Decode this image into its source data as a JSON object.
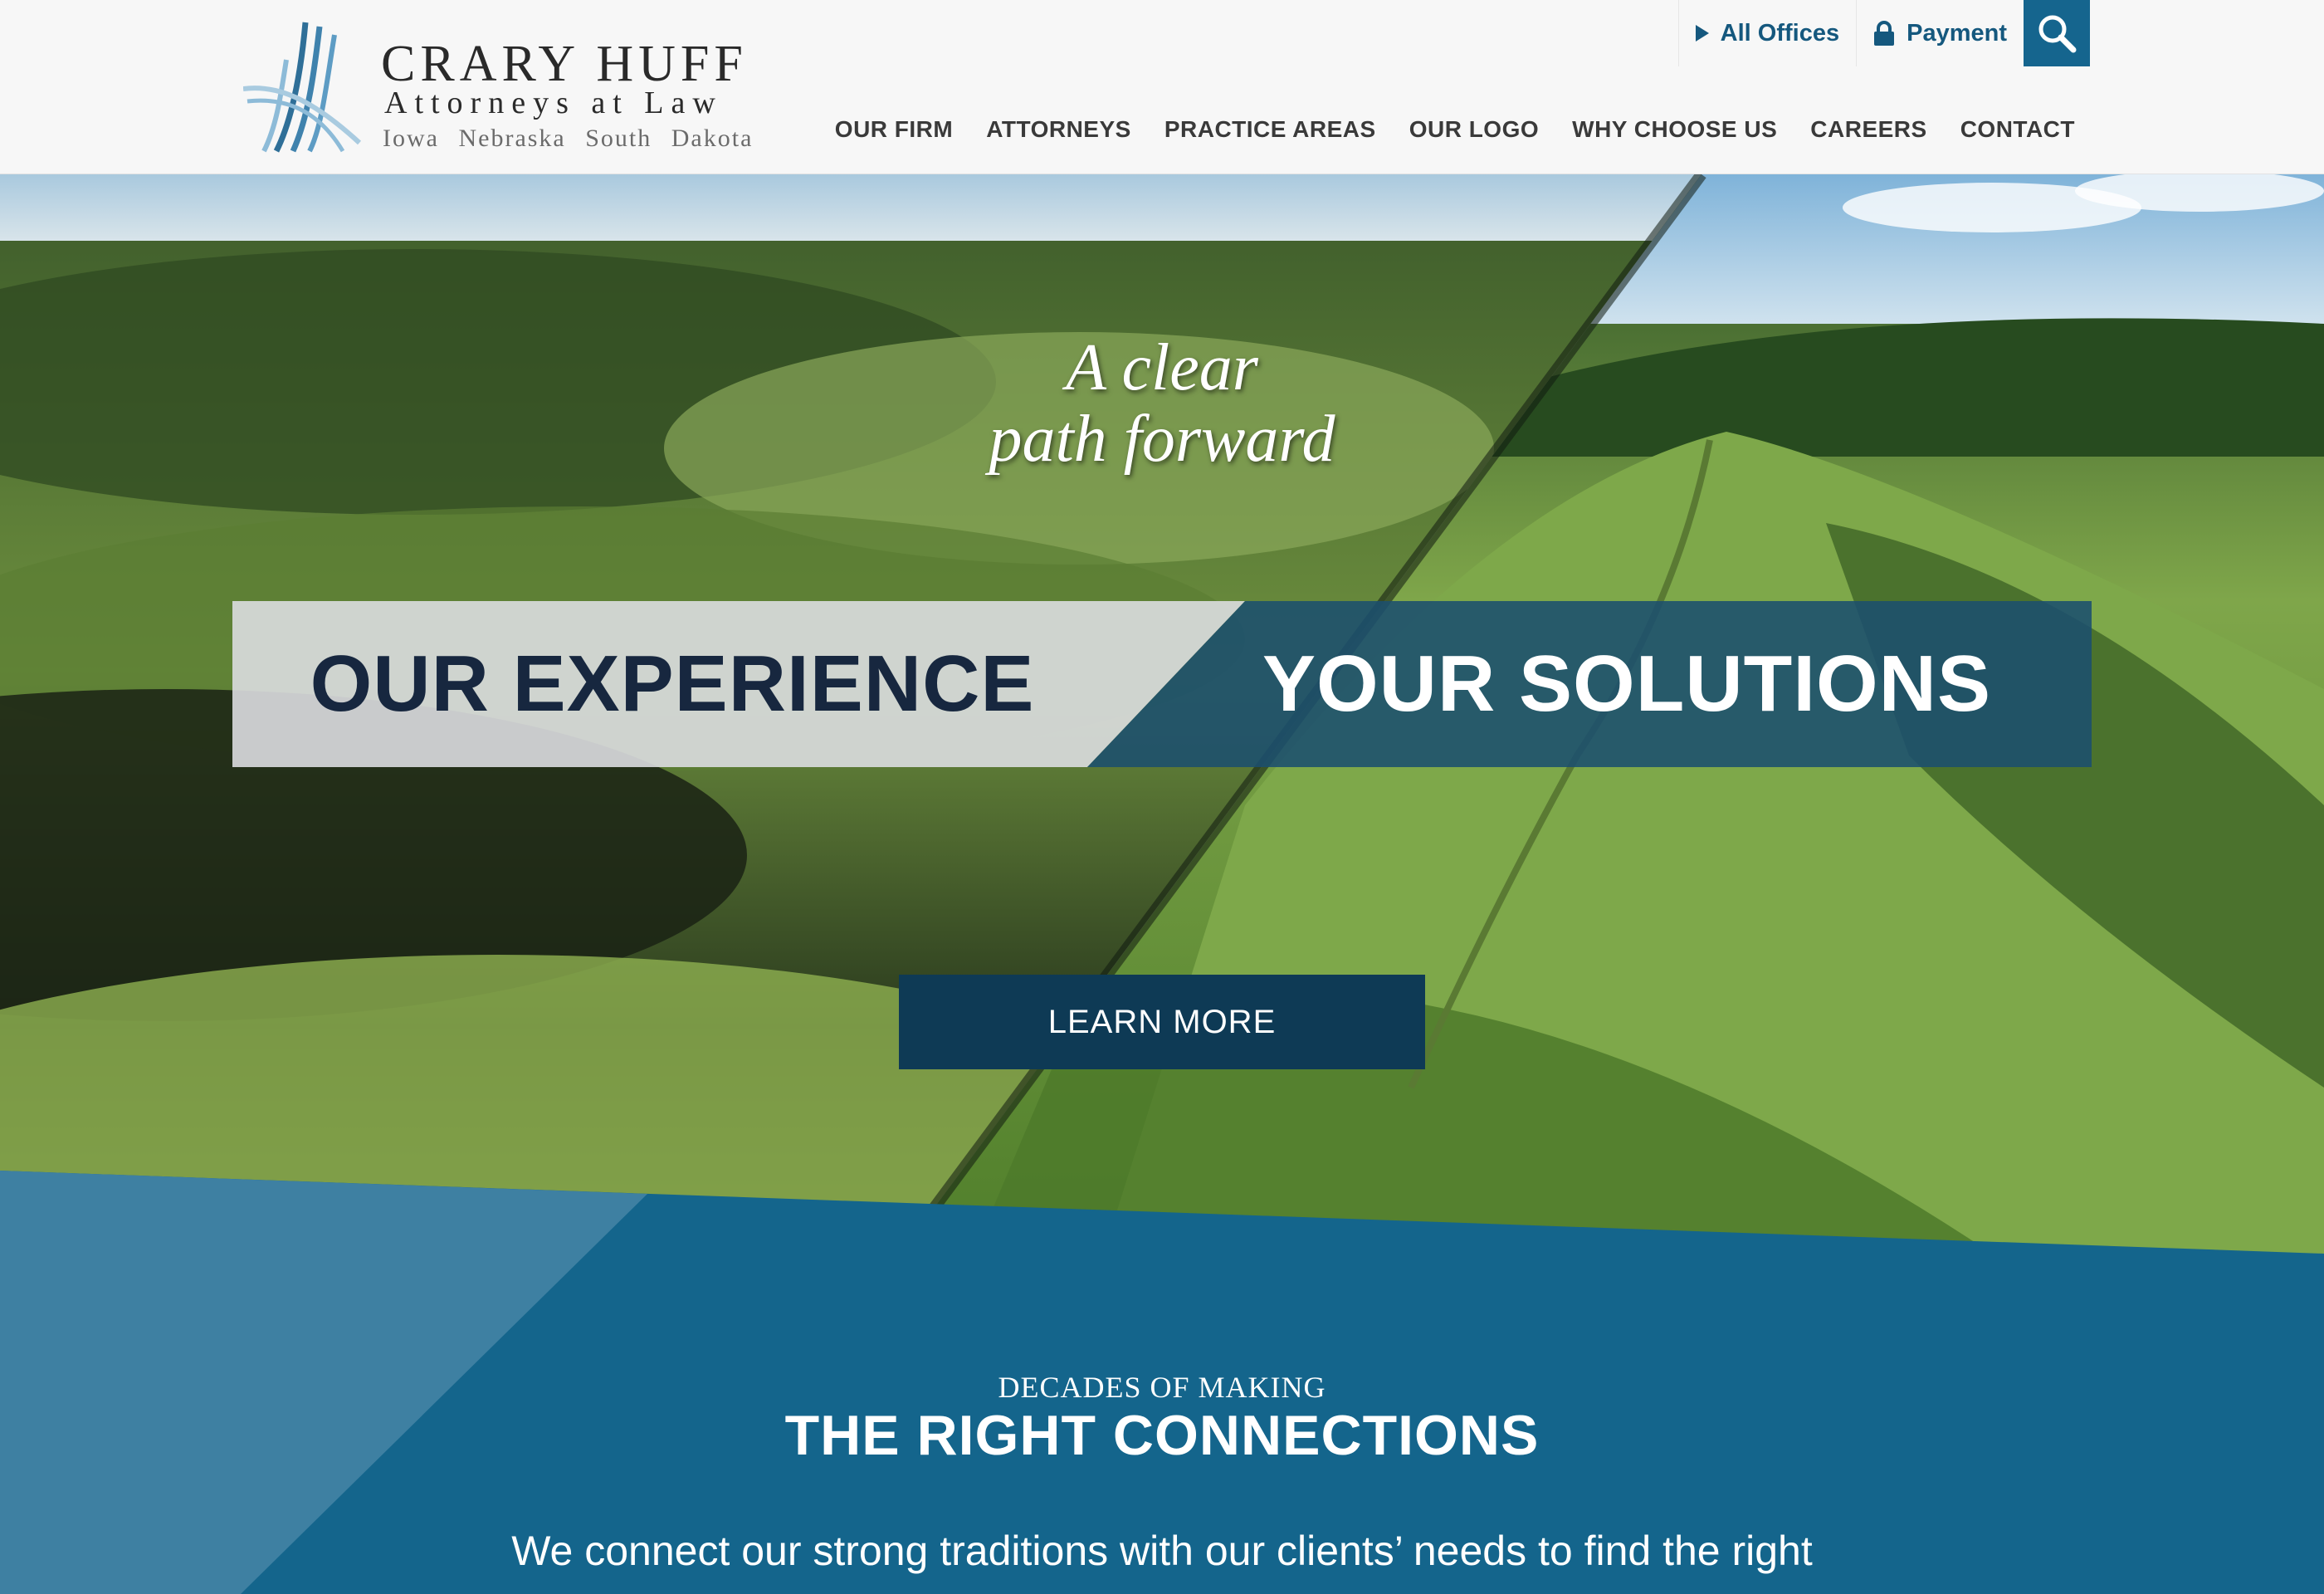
{
  "header": {
    "logo": {
      "brand": "CRARY HUFF",
      "tagline": "Attorneys at Law",
      "states": "Iowa Nebraska South Dakota"
    },
    "utility": {
      "offices_label": "All Offices",
      "payment_label": "Payment"
    },
    "nav": [
      "OUR FIRM",
      "ATTORNEYS",
      "PRACTICE AREAS",
      "OUR LOGO",
      "WHY CHOOSE US",
      "CAREERS",
      "CONTACT"
    ]
  },
  "hero": {
    "tagline_line1": "A clear",
    "tagline_line2": "path forward",
    "banner_left": "OUR EXPERIENCE",
    "banner_right": "YOUR SOLUTIONS",
    "cta_label": "LEARN MORE"
  },
  "intro": {
    "eyebrow": "DECADES OF MAKING",
    "heading": "THE RIGHT CONNECTIONS",
    "paragraph": "We connect our strong traditions with our clients’ needs to find the right"
  },
  "colors": {
    "brand_blue": "#15658e",
    "navy": "#0e3a55",
    "section_blue": "#14658c"
  }
}
